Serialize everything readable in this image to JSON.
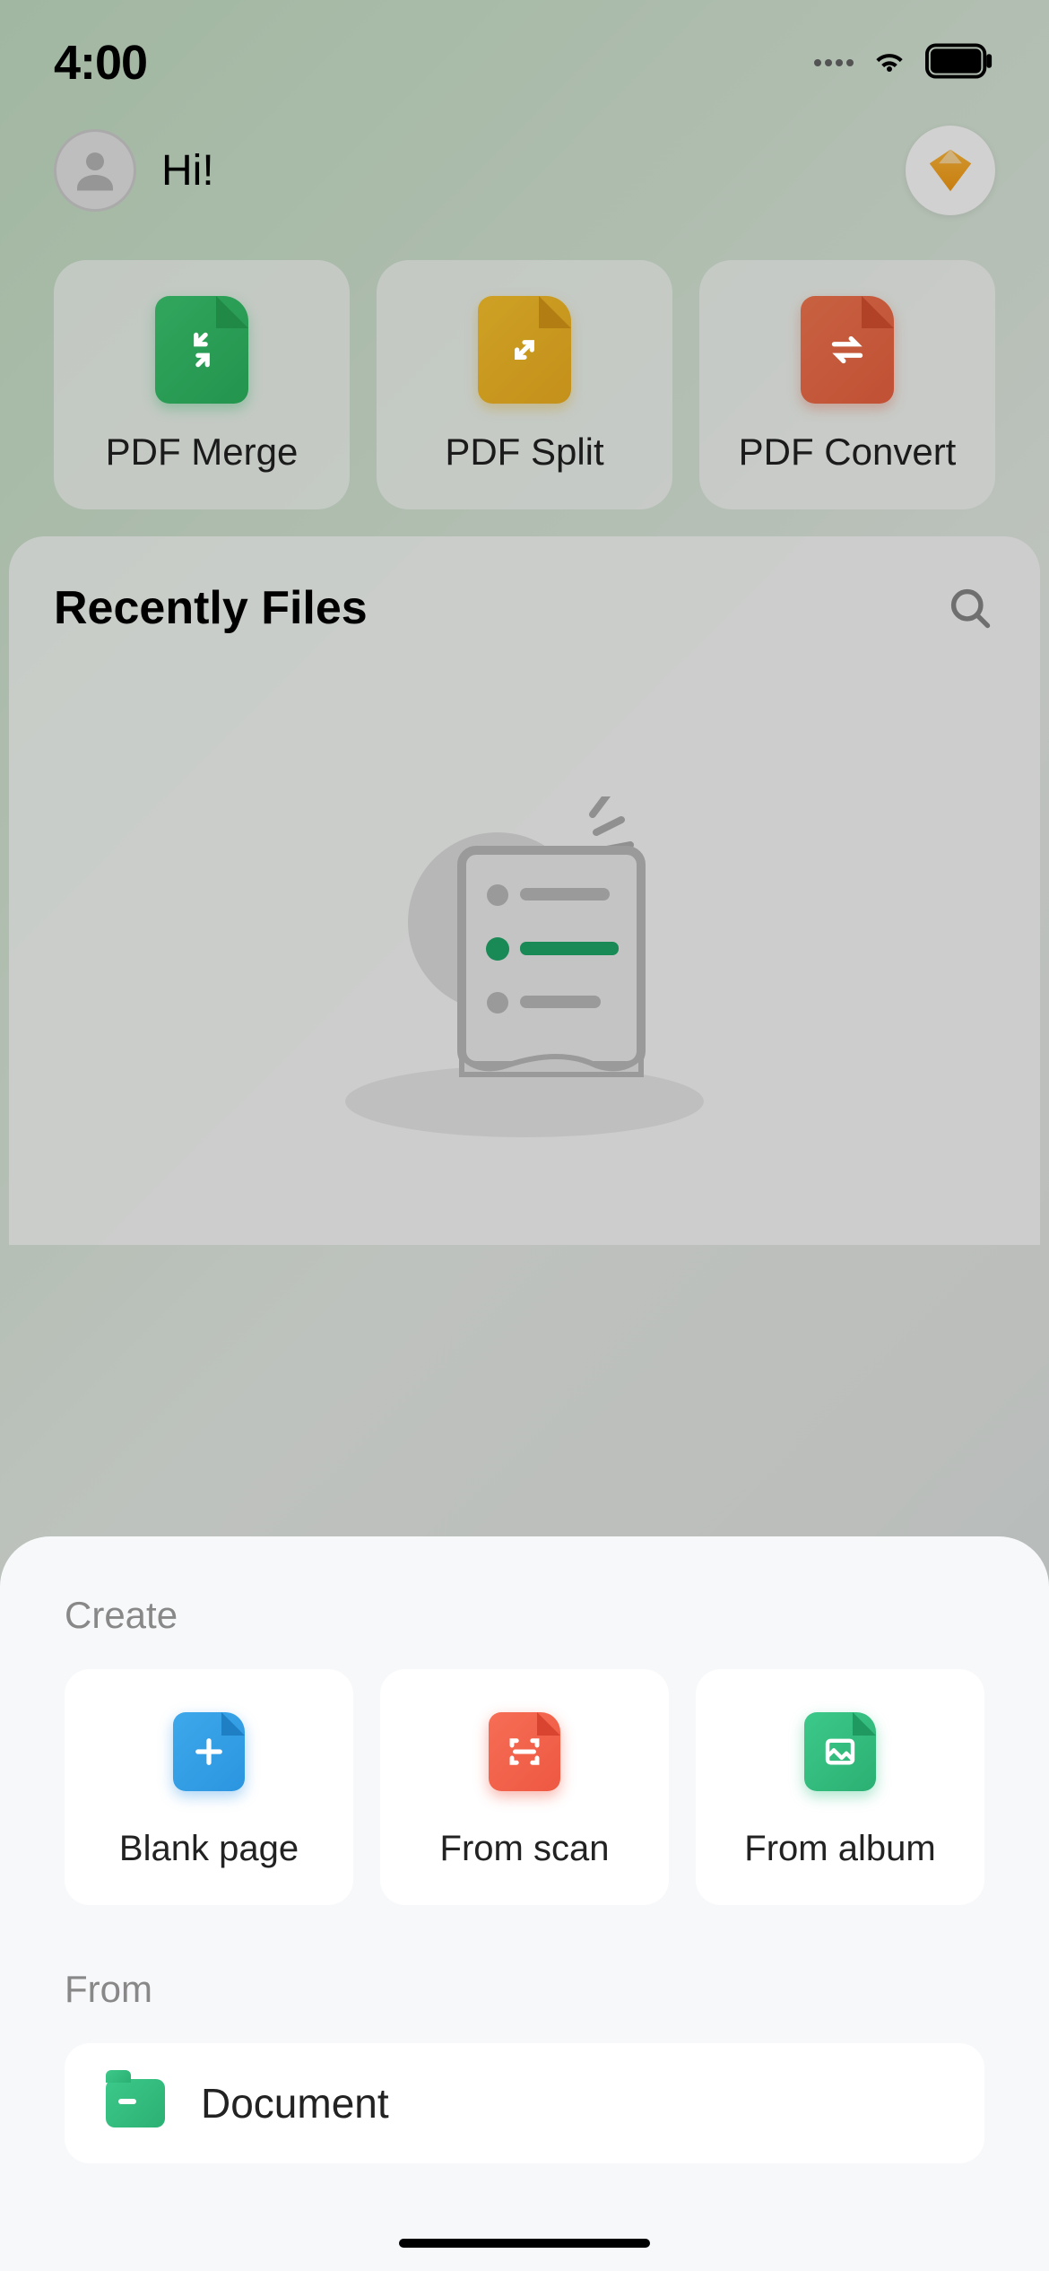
{
  "status": {
    "time": "4:00"
  },
  "header": {
    "greeting": "Hi!"
  },
  "tools": [
    {
      "label": "PDF Merge",
      "icon": "merge"
    },
    {
      "label": "PDF Split",
      "icon": "split"
    },
    {
      "label": "PDF Convert",
      "icon": "convert"
    }
  ],
  "recent": {
    "title": "Recently Files"
  },
  "sheet": {
    "create_title": "Create",
    "from_title": "From",
    "create_options": [
      {
        "label": "Blank page",
        "icon": "plus"
      },
      {
        "label": "From scan",
        "icon": "scan"
      },
      {
        "label": "From album",
        "icon": "image"
      }
    ],
    "from_options": [
      {
        "label": "Document",
        "icon": "folder"
      }
    ]
  }
}
